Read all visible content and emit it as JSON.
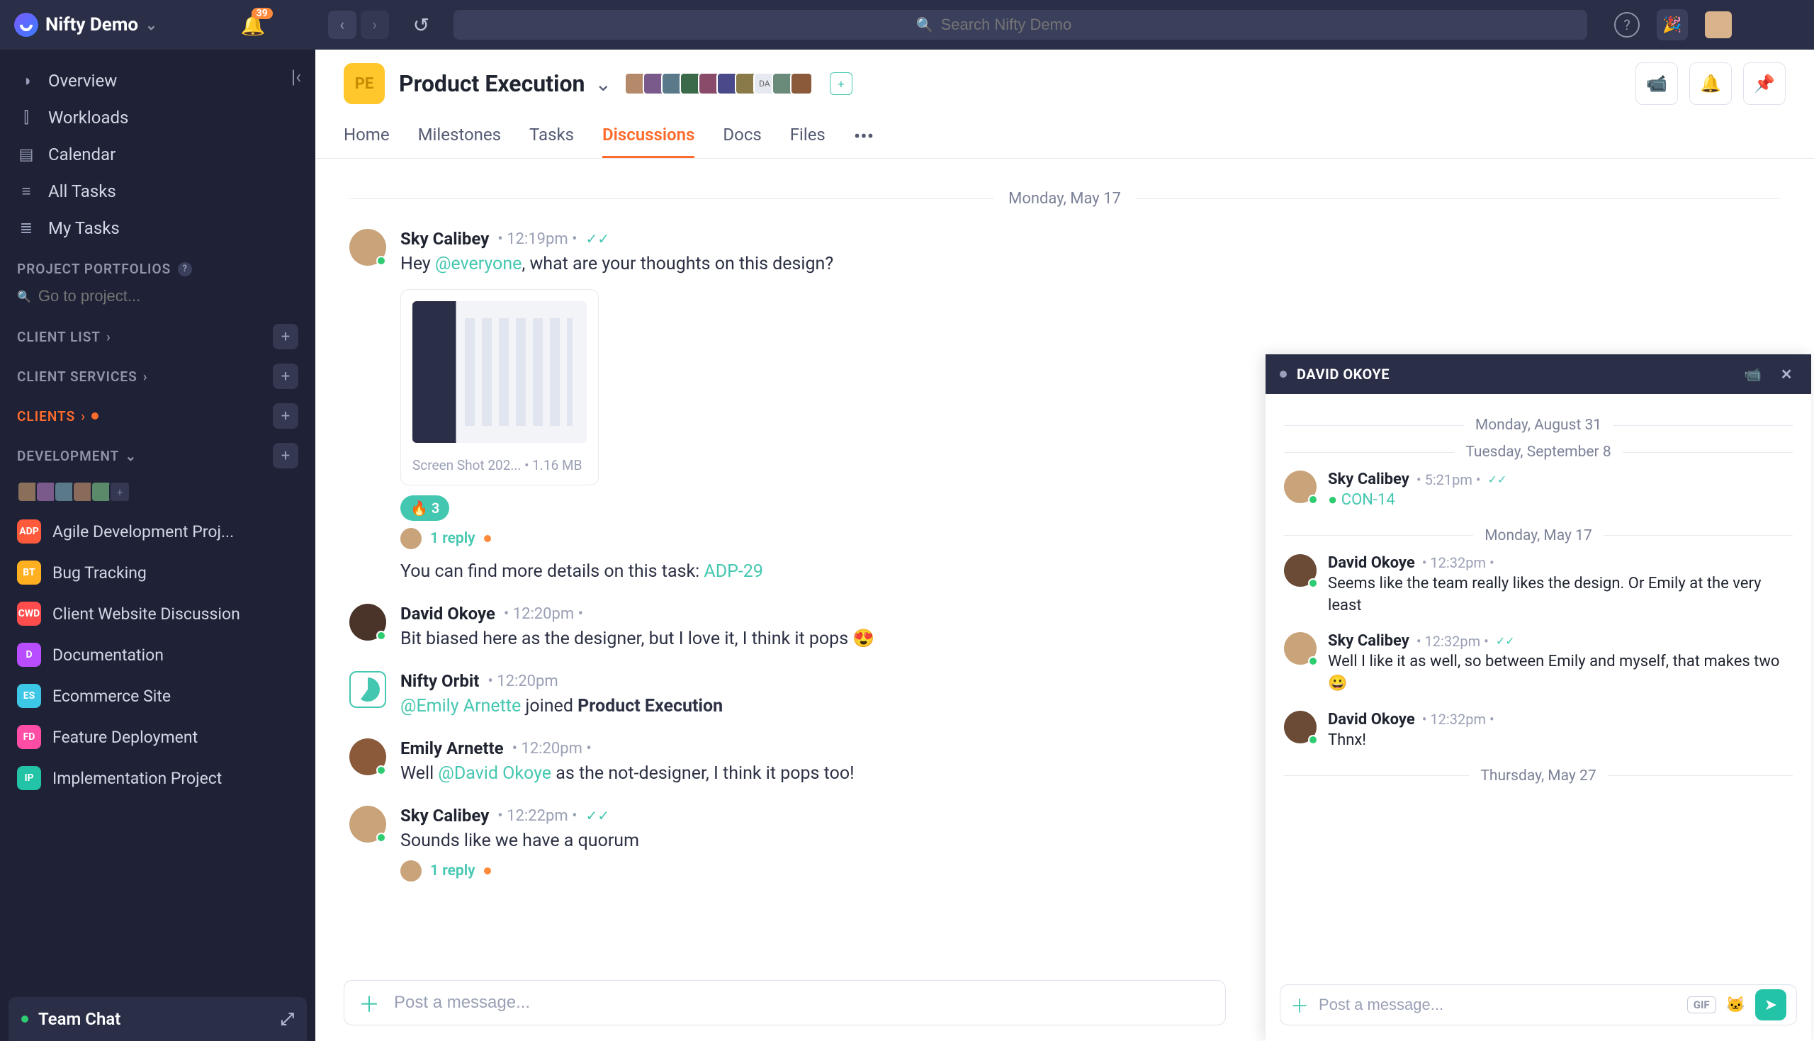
{
  "top": {
    "workspace": "Nifty Demo",
    "notif_count": "39",
    "search_placeholder": "Search Nifty Demo"
  },
  "sidebar": {
    "nav": [
      {
        "icon": "◑",
        "label": "Overview"
      },
      {
        "icon": "⫿",
        "label": "Workloads"
      },
      {
        "icon": "▤",
        "label": "Calendar"
      },
      {
        "icon": "≡",
        "label": "All Tasks"
      },
      {
        "icon": "≣",
        "label": "My Tasks"
      }
    ],
    "portfolios_label": "PROJECT PORTFOLIOS",
    "goto_placeholder": "Go to project...",
    "groups": [
      {
        "label": "CLIENT LIST",
        "active": false,
        "chev": "›"
      },
      {
        "label": "CLIENT SERVICES",
        "active": false,
        "chev": "›"
      },
      {
        "label": "CLIENTS",
        "active": true,
        "chev": "›"
      },
      {
        "label": "DEVELOPMENT",
        "active": false,
        "chev": "⌄"
      }
    ],
    "projects": [
      {
        "badge": "ADP",
        "color": "#ff5a3c",
        "label": "Agile Development Proj..."
      },
      {
        "badge": "BT",
        "color": "#ffb020",
        "label": "Bug Tracking"
      },
      {
        "badge": "CWD",
        "color": "#ff4d4d",
        "label": "Client Website Discussion"
      },
      {
        "badge": "D",
        "color": "#b84dff",
        "label": "Documentation"
      },
      {
        "badge": "ES",
        "color": "#3cc7e6",
        "label": "Ecommerce Site"
      },
      {
        "badge": "FD",
        "color": "#ff4da6",
        "label": "Feature Deployment"
      },
      {
        "badge": "IP",
        "color": "#22c3a6",
        "label": "Implementation Project"
      }
    ],
    "team_chat": "Team Chat"
  },
  "project": {
    "badge": "PE",
    "title": "Product Execution",
    "tabs": [
      "Home",
      "Milestones",
      "Tasks",
      "Discussions",
      "Docs",
      "Files"
    ],
    "active_tab": 3,
    "member_overflow": "DA"
  },
  "chat": {
    "date": "Monday, May 17",
    "messages": [
      {
        "av": "#c9a47a",
        "name": "Sky Calibey",
        "time": "12:19pm",
        "checks": true,
        "parts": [
          {
            "t": "Hey "
          },
          {
            "t": "@everyone",
            "m": true
          },
          {
            "t": ", what are your thoughts on this design?"
          }
        ],
        "attachment": {
          "name": "Screen Shot 202...",
          "size": "1.16 MB"
        },
        "reaction": {
          "emoji": "🔥",
          "count": "3"
        },
        "reply": "1 reply",
        "followup": {
          "text": "You can find more details on this task: ",
          "link": "ADP-29"
        }
      },
      {
        "av": "#4a342a",
        "name": "David Okoye",
        "time": "12:20pm",
        "parts": [
          {
            "t": "Bit biased here as the designer, but I love it, I think it pops 😍"
          }
        ]
      },
      {
        "notice": true,
        "name": "Nifty Orbit",
        "time": "12:20pm",
        "mention": "@Emily Arnette",
        "tail": " joined ",
        "bold": "Product Execution"
      },
      {
        "av": "#8a5a3a",
        "name": "Emily Arnette",
        "time": "12:20pm",
        "parts": [
          {
            "t": "Well "
          },
          {
            "t": "@David Okoye",
            "m": true
          },
          {
            "t": " as the not-designer, I think it pops too!"
          }
        ]
      },
      {
        "av": "#c9a47a",
        "name": "Sky Calibey",
        "time": "12:22pm",
        "checks": true,
        "parts": [
          {
            "t": "Sounds like we have a quorum"
          }
        ],
        "reply": "1 reply"
      }
    ],
    "composer_placeholder": "Post a message..."
  },
  "dm": {
    "title": "DAVID OKOYE",
    "seps": [
      "Monday, August 31",
      "Tuesday, September 8",
      "Monday, May 17",
      "Thursday, May 27"
    ],
    "msgs": [
      {
        "sep": 1,
        "av": "#c9a47a",
        "name": "Sky Calibey",
        "time": "5:21pm",
        "checks": true,
        "link": "CON-14"
      },
      {
        "sep": 2,
        "av": "#6b4a36",
        "name": "David Okoye",
        "time": "12:32pm",
        "text": "Seems like the team really likes the design. Or Emily at the very least"
      },
      {
        "sep": 2,
        "av": "#c9a47a",
        "name": "Sky Calibey",
        "time": "12:32pm",
        "checks": true,
        "text": "Well I like it as well, so between Emily and myself, that makes two 😀"
      },
      {
        "sep": 2,
        "av": "#6b4a36",
        "name": "David Okoye",
        "time": "12:32pm",
        "text": "Thnx!"
      }
    ],
    "composer_placeholder": "Post a message...",
    "gif": "GIF"
  }
}
